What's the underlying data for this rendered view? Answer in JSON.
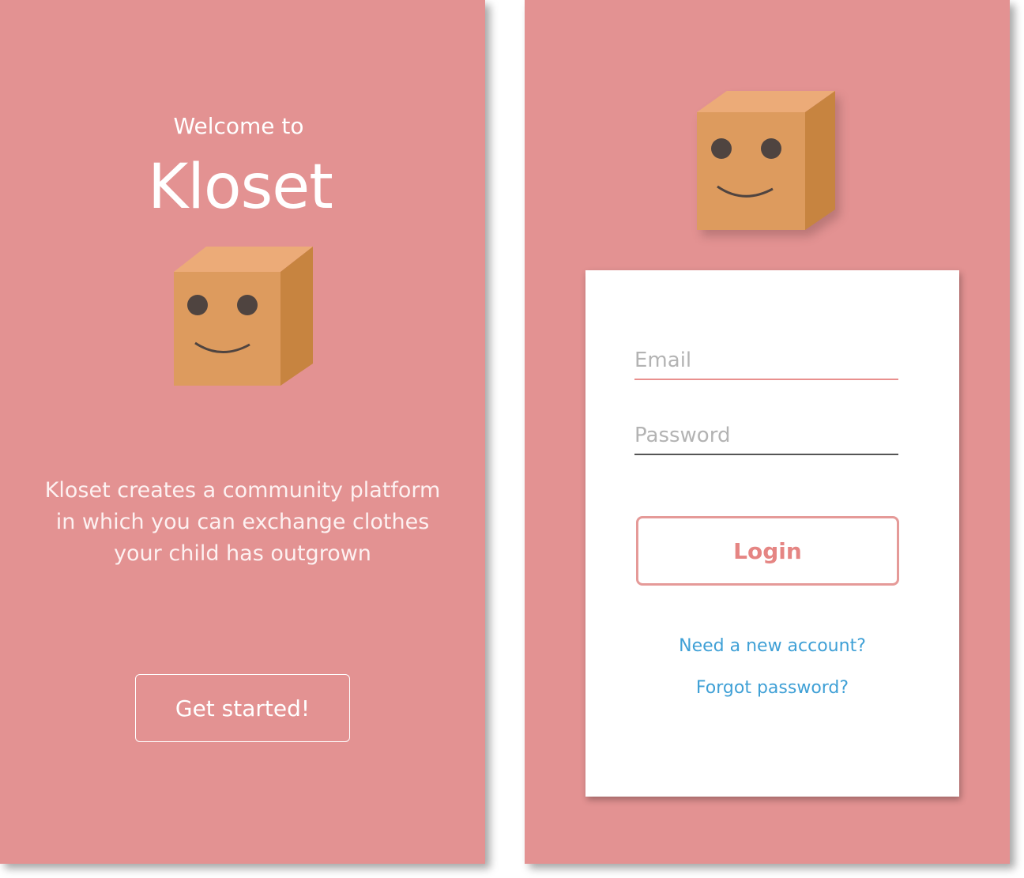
{
  "welcome_screen": {
    "greeting": "Welcome to",
    "app_name": "Kloset",
    "tagline_lines": [
      "Kloset creates a community platform",
      "in which you can exchange clothes",
      "your child has outgrown"
    ],
    "cta_label": "Get started!"
  },
  "login_screen": {
    "email_placeholder": "Email",
    "password_placeholder": "Password",
    "login_label": "Login",
    "new_account_link": "Need a new account?",
    "forgot_password_link": "Forgot password?"
  },
  "colors": {
    "background": "#e39292",
    "box_front": "#dd9b5e",
    "box_top": "#ecab78",
    "box_side": "#c78440",
    "link": "#3fa0d6",
    "accent": "#e58583"
  },
  "icons": {
    "mascot": "smiling-box-icon"
  }
}
